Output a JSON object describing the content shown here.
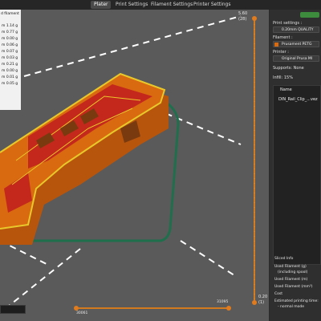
{
  "tabs": [
    "Plater",
    "Print Settings",
    "Filament Settings",
    "Printer Settings"
  ],
  "legend": {
    "header": "d filament",
    "rows": [
      {
        "m": "m",
        "g": "1.14 g"
      },
      {
        "m": "m",
        "g": "0.77 g"
      },
      {
        "m": "m",
        "g": "0.00 g"
      },
      {
        "m": "m",
        "g": "0.06 g"
      },
      {
        "m": "m",
        "g": "0.07 g"
      },
      {
        "m": "m",
        "g": "0.03 g"
      },
      {
        "m": "m",
        "g": "0.21 g"
      },
      {
        "m": "m",
        "g": "0.00 g"
      },
      {
        "m": "m",
        "g": "0.01 g"
      },
      {
        "m": "m",
        "g": "0.05 g"
      }
    ]
  },
  "vscale": {
    "top": "5.60",
    "top_layer": "(28)",
    "bottom": "0.20",
    "bottom_layer": "(1)"
  },
  "hslider": {
    "left": "30061",
    "right": "31095"
  },
  "right_panel": {
    "print_settings_label": "Print settings :",
    "print_settings_value": "0.20mm QUALITY",
    "filament_label": "Filament :",
    "filament_value": "Prusament PETG",
    "printer_label": "Printer :",
    "printer_value": "Original Prusa MI",
    "supports_label": "Supports:",
    "supports_value": "None",
    "infill_label": "Infill:",
    "infill_value": "15%",
    "list_header": "Name",
    "list_item": "DIN_Rail_Clip_...vez",
    "sliced_header": "Sliced Info",
    "used_g": "Used Filament (g)",
    "including_spool": "(including spool)",
    "used_m": "Used Filament (m)",
    "used_mm3": "Used Filament (mm³)",
    "cost": "Cost",
    "est_time": "Estimated printing time:",
    "normal_mode": "- normal mode"
  },
  "colors": {
    "perimeter": "#d96a10",
    "outer": "#e8c82a",
    "top_solid": "#c4281c",
    "skirt": "#1f6f4d",
    "background": "#5a5a5a",
    "accent_toggle": "#3d8b3d"
  }
}
